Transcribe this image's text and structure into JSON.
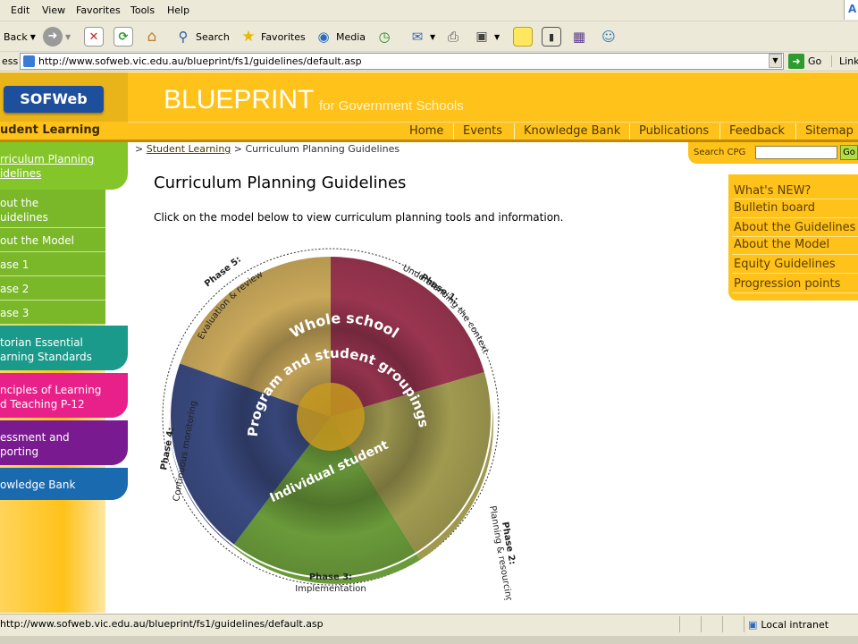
{
  "menu": {
    "items": [
      "Edit",
      "View",
      "Favorites",
      "Tools",
      "Help"
    ],
    "corner_logo": "A"
  },
  "toolbar": {
    "back_label": "Back",
    "search_label": "Search",
    "favorites_label": "Favorites",
    "media_label": "Media"
  },
  "address": {
    "label": "ess",
    "url": "http://www.sofweb.vic.edu.au/blueprint/fs1/guidelines/default.asp",
    "go_label": "Go",
    "links_label": "Links"
  },
  "site": {
    "logo_text": "SOFWeb",
    "brand_title": "BLUEPRINT",
    "brand_subtitle": "for Government Schools",
    "section_title": "udent Learning",
    "nav": [
      "Home",
      "Events",
      "Knowledge Bank",
      "Publications",
      "Feedback",
      "Sitemap"
    ]
  },
  "sidebar": {
    "items": [
      {
        "label": "rriculum Planning\nidelines",
        "color": "#84c52a"
      },
      {
        "label": "out the\nuidelines",
        "color": "#7ab82a"
      },
      {
        "label": "out the Model",
        "color": "#7ab82a"
      },
      {
        "label": "ase 1",
        "color": "#7ab82a"
      },
      {
        "label": "ase 2",
        "color": "#7ab82a"
      },
      {
        "label": "ase 3",
        "color": "#7ab82a"
      },
      {
        "label": "torian Essential\narning Standards",
        "color": "#1a9a8a"
      },
      {
        "label": "nciples of Learning\nd Teaching P-12",
        "color": "#e8208a"
      },
      {
        "label": "essment and\nporting",
        "color": "#7a1a90"
      },
      {
        "label": "owledge Bank",
        "color": "#1a6ab0"
      }
    ]
  },
  "breadcrumb": {
    "prefix": ">",
    "link": "Student Learning",
    "separator": ">",
    "current": "Curriculum Planning Guidelines"
  },
  "main": {
    "title": "Curriculum Planning Guidelines",
    "intro": "Click on the model below to view curriculum planning tools and information."
  },
  "model": {
    "rings": [
      "Whole school",
      "Program and student groupings",
      "Individual student"
    ],
    "phases": [
      {
        "title": "Phase 1:",
        "subtitle": "Understanding the context"
      },
      {
        "title": "Phase 2:",
        "subtitle": "Planning & resourcing"
      },
      {
        "title": "Phase 3:",
        "subtitle": "Implementation"
      },
      {
        "title": "Phase 4:",
        "subtitle": "Continuous monitoring"
      },
      {
        "title": "Phase 5:",
        "subtitle": "Evaluation & review"
      }
    ],
    "colors": {
      "whole": "#c9a85a",
      "program_red": "#9a3550",
      "olive": "#a09a50",
      "green": "#6a9a3a",
      "navy": "#3a4a80",
      "core": "#c89a20"
    }
  },
  "search": {
    "label": "Search CPG",
    "go_label": "Go"
  },
  "rightpanel": {
    "items": [
      "What's NEW?",
      "Bulletin board",
      "About the Guidelines",
      "About the Model",
      "Equity Guidelines",
      "Progression points"
    ]
  },
  "status": {
    "url": "http://www.sofweb.vic.edu.au/blueprint/fs1/guidelines/default.asp",
    "zone": "Local intranet"
  }
}
